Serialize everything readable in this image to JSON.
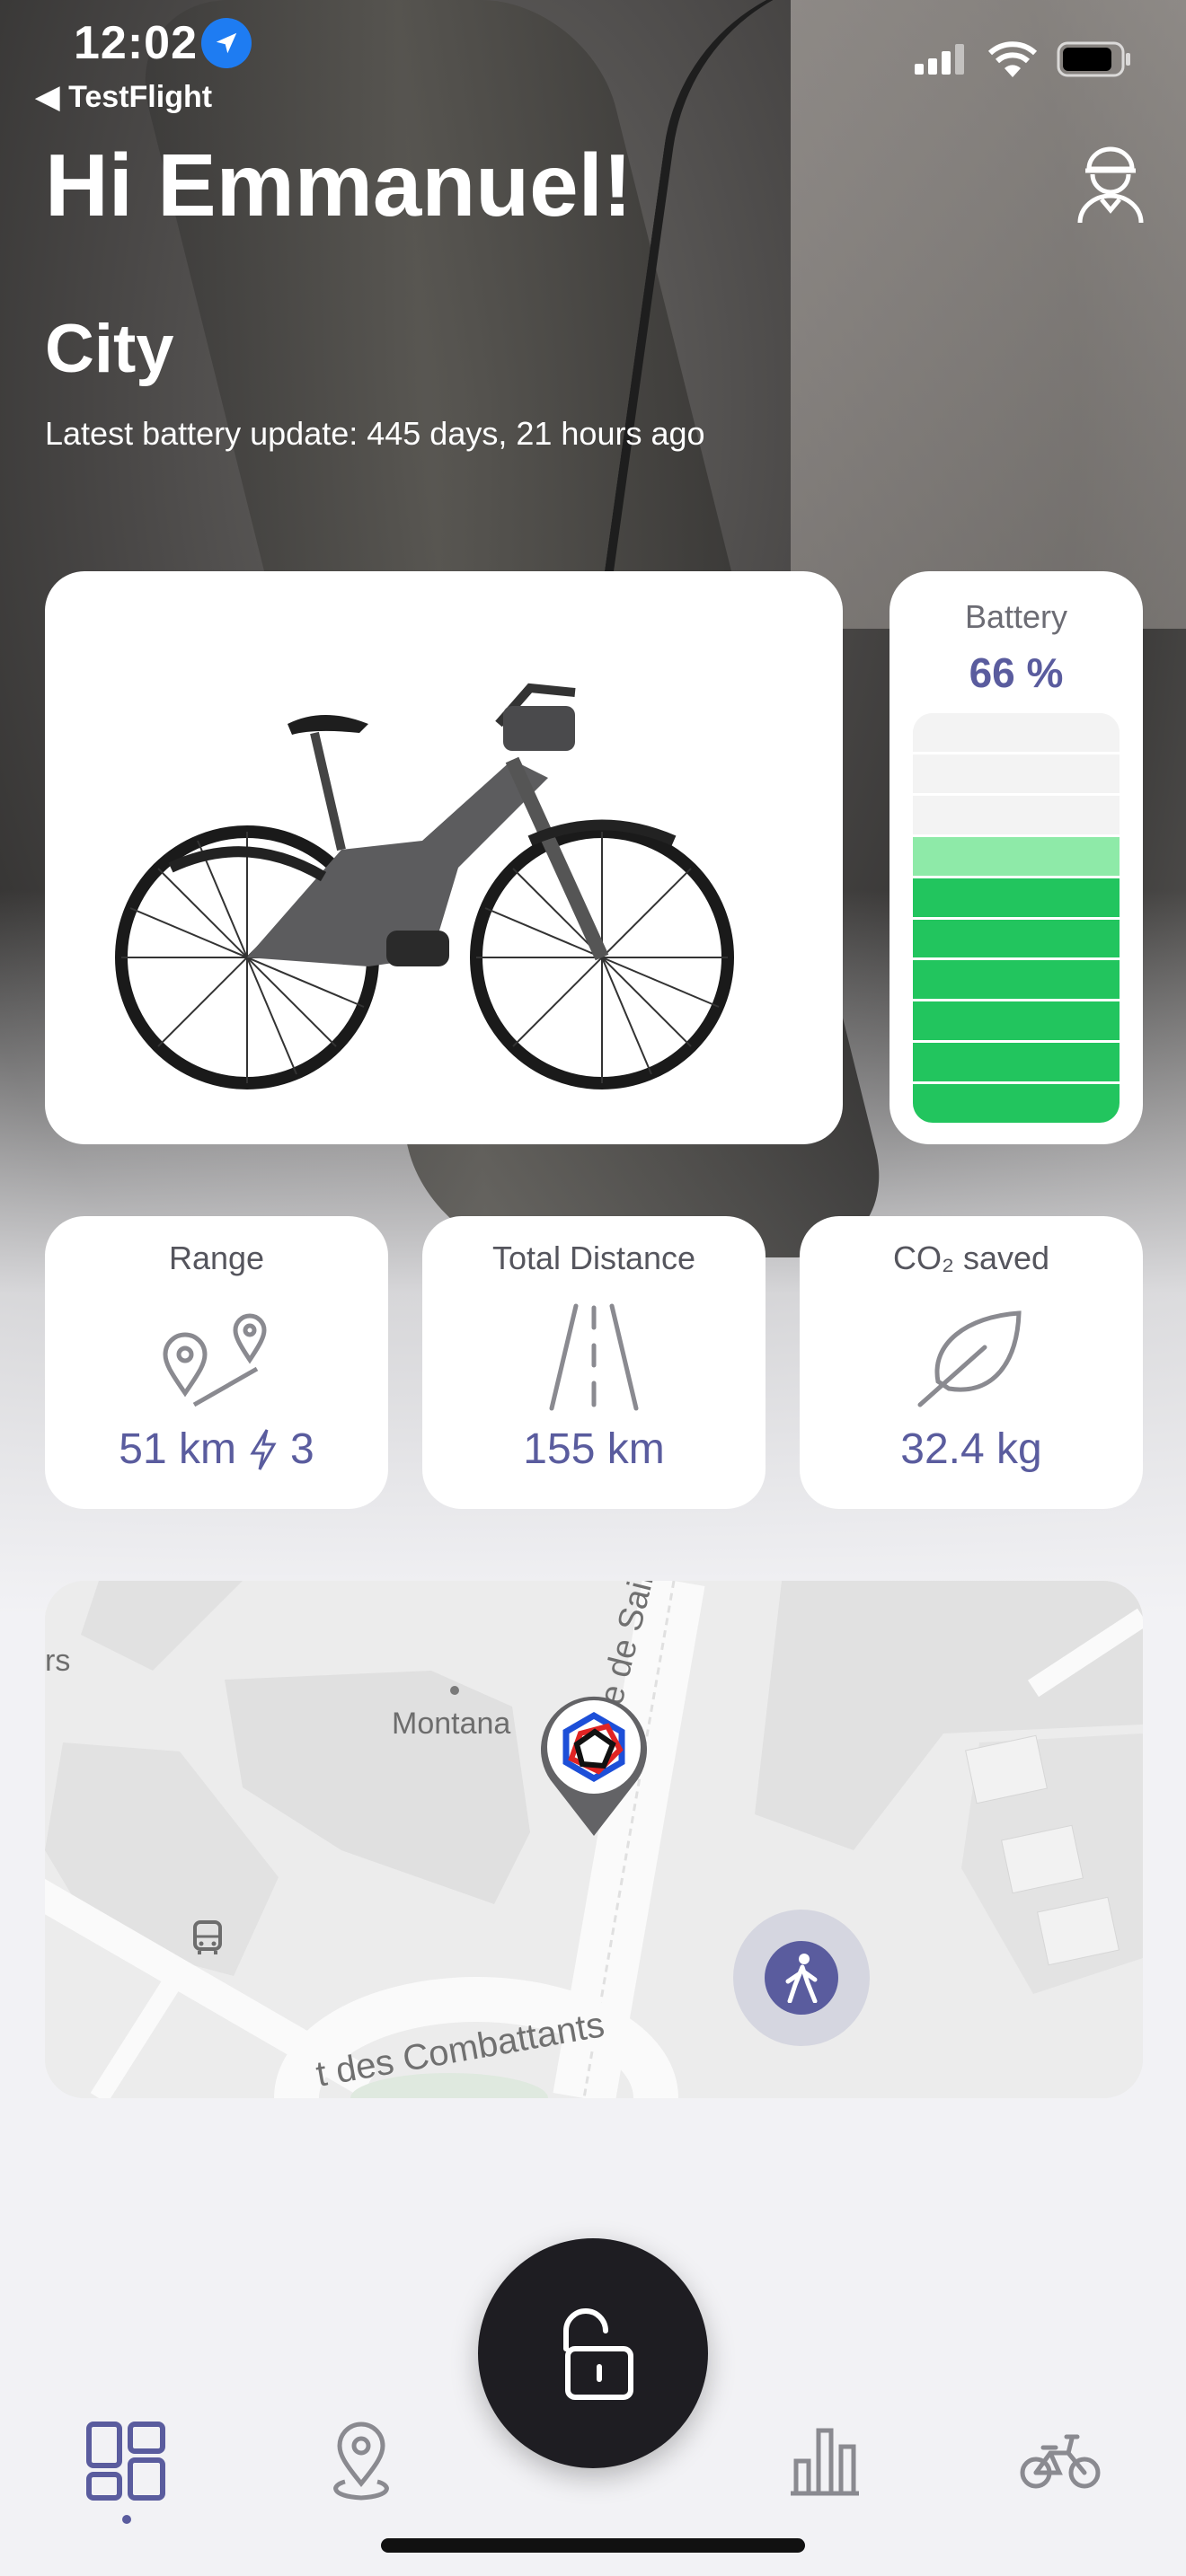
{
  "status_bar": {
    "time": "12:02",
    "back_app": "TestFlight"
  },
  "header": {
    "greeting": "Hi Emmanuel!"
  },
  "bike": {
    "mode": "City",
    "battery_update": "Latest battery update: 445 days, 21 hours ago"
  },
  "battery": {
    "title": "Battery",
    "value": "66 %",
    "level_fraction": 0.66,
    "colors": {
      "full": "#22c55e",
      "partial": "#8eeaa8",
      "empty": "#f3f3f3"
    }
  },
  "stats": {
    "range": {
      "title": "Range",
      "value": "51 km",
      "boost": "3"
    },
    "distance": {
      "title": "Total Distance",
      "value": "155 km"
    },
    "co2": {
      "title": "CO₂ saved",
      "value": "32.4 kg"
    }
  },
  "map": {
    "labels": {
      "montana": "Montana",
      "route": "Route de Saint-Jose",
      "combattants": "t des Combattants",
      "edge": "rs"
    }
  },
  "accent": "#5a5c9e",
  "tabs": [
    "dashboard",
    "map",
    "unlock",
    "stats",
    "bike"
  ]
}
